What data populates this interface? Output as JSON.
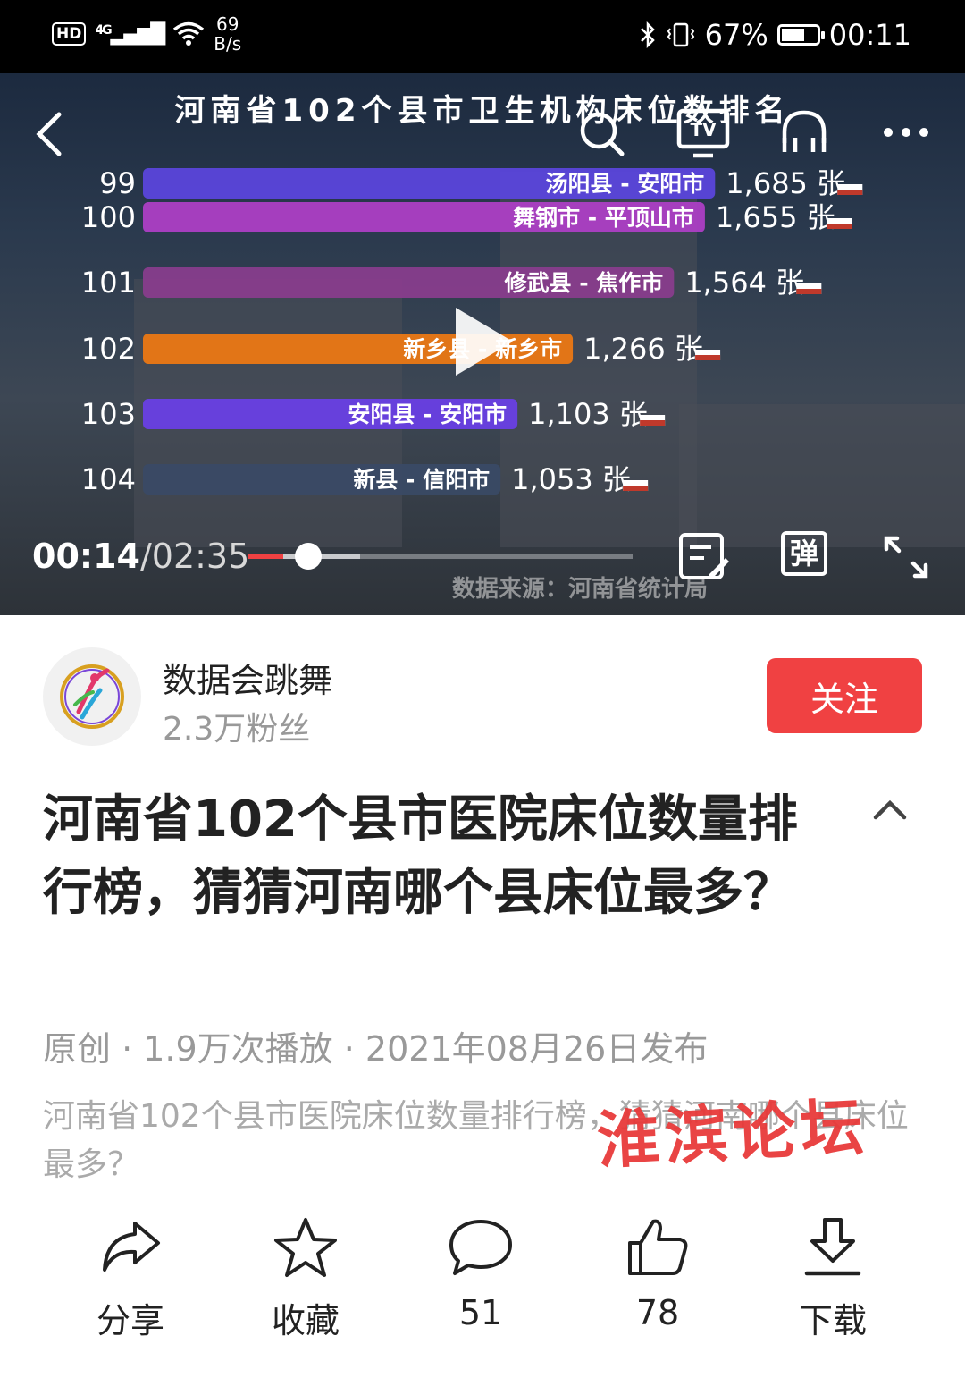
{
  "status_bar": {
    "hd": "HD",
    "network": "4G",
    "net_speed_value": "69",
    "net_speed_unit": "B/s",
    "battery": "67%",
    "battery_level": 0.67,
    "time": "00:11"
  },
  "video": {
    "playback": {
      "current": "00:14",
      "total": "/02:35",
      "progress": 0.09,
      "buffered": 0.29
    },
    "source_text": "数据来源：河南省统计局",
    "danmaku_label": "弹"
  },
  "chart_data": {
    "type": "bar",
    "orientation": "horizontal",
    "title": "河南省102个县市卫生机构床位数排名",
    "unit": "张",
    "rows": [
      {
        "rank": "99",
        "label": "汤阳县 - 安阳市",
        "value": 1685,
        "value_text": "1,685 张",
        "color": "#5b45e0"
      },
      {
        "rank": "100",
        "label": "舞钢市 - 平顶山市",
        "value": 1655,
        "value_text": "1,655 张",
        "color": "#b03fc8"
      },
      {
        "rank": "101",
        "label": "修武县 - 焦作市",
        "value": 1564,
        "value_text": "1,564 张",
        "color": "#8a3d8e"
      },
      {
        "rank": "102",
        "label": "新乡县 - 新乡市",
        "value": 1266,
        "value_text": "1,266 张",
        "color": "#f07a12"
      },
      {
        "rank": "103",
        "label": "安阳县 - 安阳市",
        "value": 1103,
        "value_text": "1,103 张",
        "color": "#6a3fe8"
      },
      {
        "rank": "104",
        "label": "新县 - 信阳市",
        "value": 1053,
        "value_text": "1,053 张",
        "color": "#3a4a66"
      }
    ]
  },
  "author": {
    "name": "数据会跳舞",
    "fans": "2.3万粉丝",
    "follow_label": "关注"
  },
  "article": {
    "title": "河南省102个县市医院床位数量排行榜，猜猜河南哪个县床位最多？",
    "meta": "原创 · 1.9万次播放 · 2021年08月26日发布",
    "description": "河南省102个县市医院床位数量排行榜，猜猜河南哪个县床位最多？",
    "watermark": "淮滨论坛"
  },
  "actions": [
    {
      "label": "分享",
      "icon": "share-icon"
    },
    {
      "label": "收藏",
      "icon": "star-icon"
    },
    {
      "label": "51",
      "icon": "comment-icon"
    },
    {
      "label": "78",
      "icon": "thumbs-up-icon"
    },
    {
      "label": "下载",
      "icon": "download-icon"
    }
  ]
}
